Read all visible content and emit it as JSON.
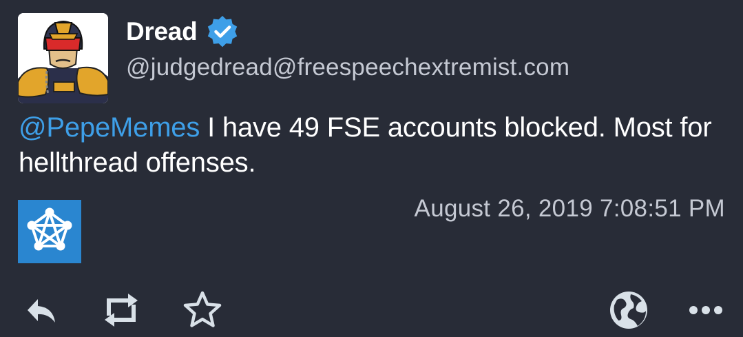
{
  "status": {
    "author": {
      "display_name": "Dread",
      "verified": true,
      "acct": "@judgedread@freespeechextremist.com",
      "avatar_icon": "judge-dredd-avatar"
    },
    "content": {
      "mention": "@PepeMemes",
      "text": " I have 49 FSE accounts blocked. Most for hellthread offenses."
    },
    "app_icon": "pleroma-network-icon",
    "timestamp": "August 26, 2019 7:08:51 PM",
    "actions": [
      "reply-icon",
      "boost-icon",
      "favourite-icon",
      "visibility-public-icon",
      "more-icon"
    ]
  },
  "colors": {
    "background": "#282c37",
    "mention": "#3e9fe8",
    "verified": "#3e9fe8",
    "app_icon_bg": "#2a86d0",
    "secondary_text": "#c5c9d3",
    "icon": "#d9e1e8"
  }
}
